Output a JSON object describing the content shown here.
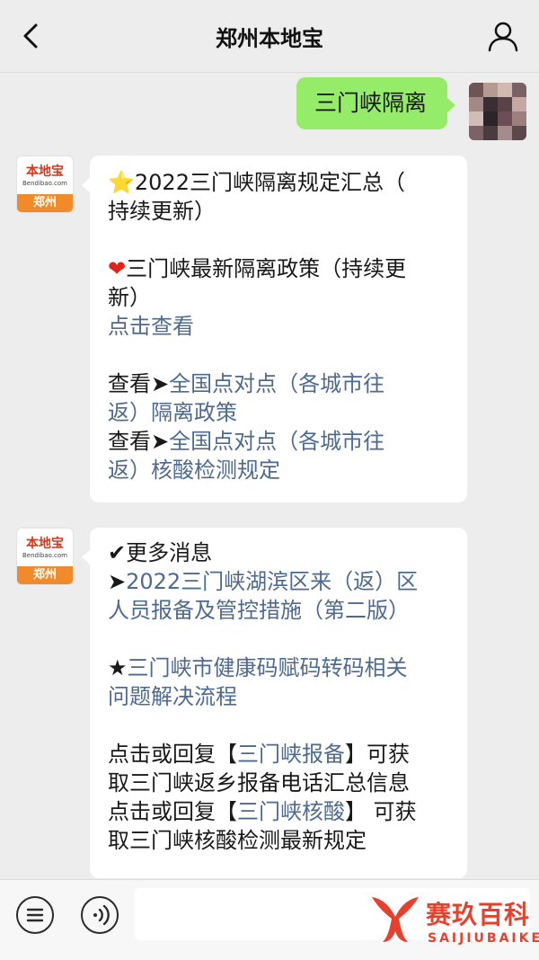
{
  "header": {
    "title": "郑州本地宝"
  },
  "outgoing": {
    "text": "三门峡隔离"
  },
  "bot_avatar": {
    "logo": "本地宝",
    "domain": "Bendibao.com",
    "city": "郑州"
  },
  "message1": {
    "line1": "2022三门峡隔离规定汇总（",
    "line2": "持续更新）",
    "line3": "三门峡最新隔离政策（持续更",
    "line4": "新）",
    "link1": "点击查看",
    "prefix1": "查看➤",
    "link2a": "全国点对点（各城市往",
    "link2b": "返）隔离政策",
    "prefix2": "查看➤",
    "link3a": "全国点对点（各城市往",
    "link3b": "返）核酸检测规定"
  },
  "message2": {
    "line1": "更多消息",
    "arrow": "➤",
    "link1a": "2022三门峡湖滨区来（返）区",
    "link1b": "人员报备及管控措施（第二版）",
    "star": "★",
    "link2a": "三门峡市健康码赋码转码相关",
    "link2b": "问题解决流程",
    "p1_pre": "点击或回复【",
    "p1_link": "三门峡报备",
    "p1_post": "】可获",
    "p1_line2": "取三门峡返乡报备电话汇总信息",
    "p2_pre": "点击或回复【",
    "p2_link": "三门峡核酸",
    "p2_post": "】 可获",
    "p2_line2": "取三门峡核酸检测最新规定"
  },
  "watermark": {
    "name": "赛玖百科",
    "pinyin": "SAIJIUBAIKE"
  },
  "colors": {
    "link": "#4f6a8f",
    "bubble_out": "#95ec69",
    "background": "#ededed"
  }
}
